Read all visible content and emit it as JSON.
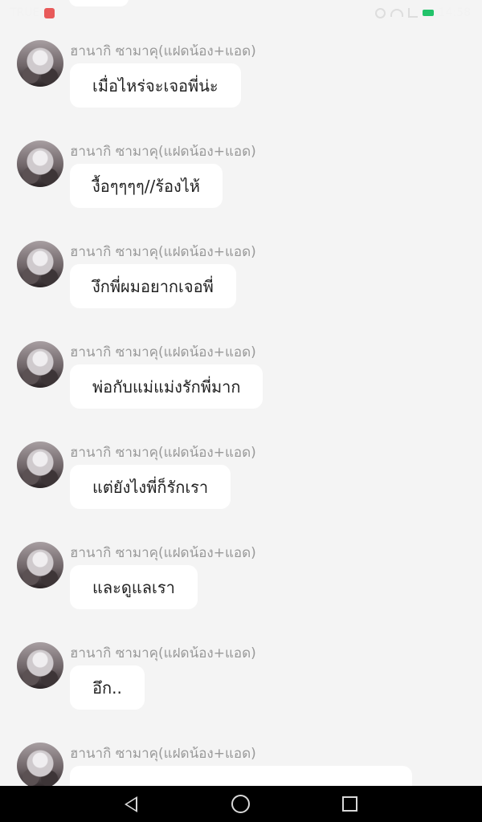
{
  "status_bar": {
    "carrier": "TRUE",
    "time": "14:58"
  },
  "messages": [
    {
      "sender": "ฮานากิ ซามาคุ(แฝดน้อง+แอด)",
      "text": "เมื่อไหร่จะเจอพี่น่ะ"
    },
    {
      "sender": "ฮานากิ ซามาคุ(แฝดน้อง+แอด)",
      "text": "งื้อๆๆๆๆ//ร้องไห้"
    },
    {
      "sender": "ฮานากิ ซามาคุ(แฝดน้อง+แอด)",
      "text": "งึกพี่ผมอยากเจอพี่"
    },
    {
      "sender": "ฮานากิ ซามาคุ(แฝดน้อง+แอด)",
      "text": "พ่อกับแม่แม่งรักพี่มาก"
    },
    {
      "sender": "ฮานากิ ซามาคุ(แฝดน้อง+แอด)",
      "text": "แต่ยังไงพี่ก็รักเรา"
    },
    {
      "sender": "ฮานากิ ซามาคุ(แฝดน้อง+แอด)",
      "text": "และดูแลเรา"
    },
    {
      "sender": "ฮานากิ ซามาคุ(แฝดน้อง+แอด)",
      "text": "อึก.."
    },
    {
      "sender": "ฮานากิ ซามาคุ(แฝดน้อง+แอด)",
      "text": ""
    }
  ],
  "nav_bar": {
    "icons": [
      "back-icon",
      "home-icon",
      "recents-icon"
    ]
  }
}
